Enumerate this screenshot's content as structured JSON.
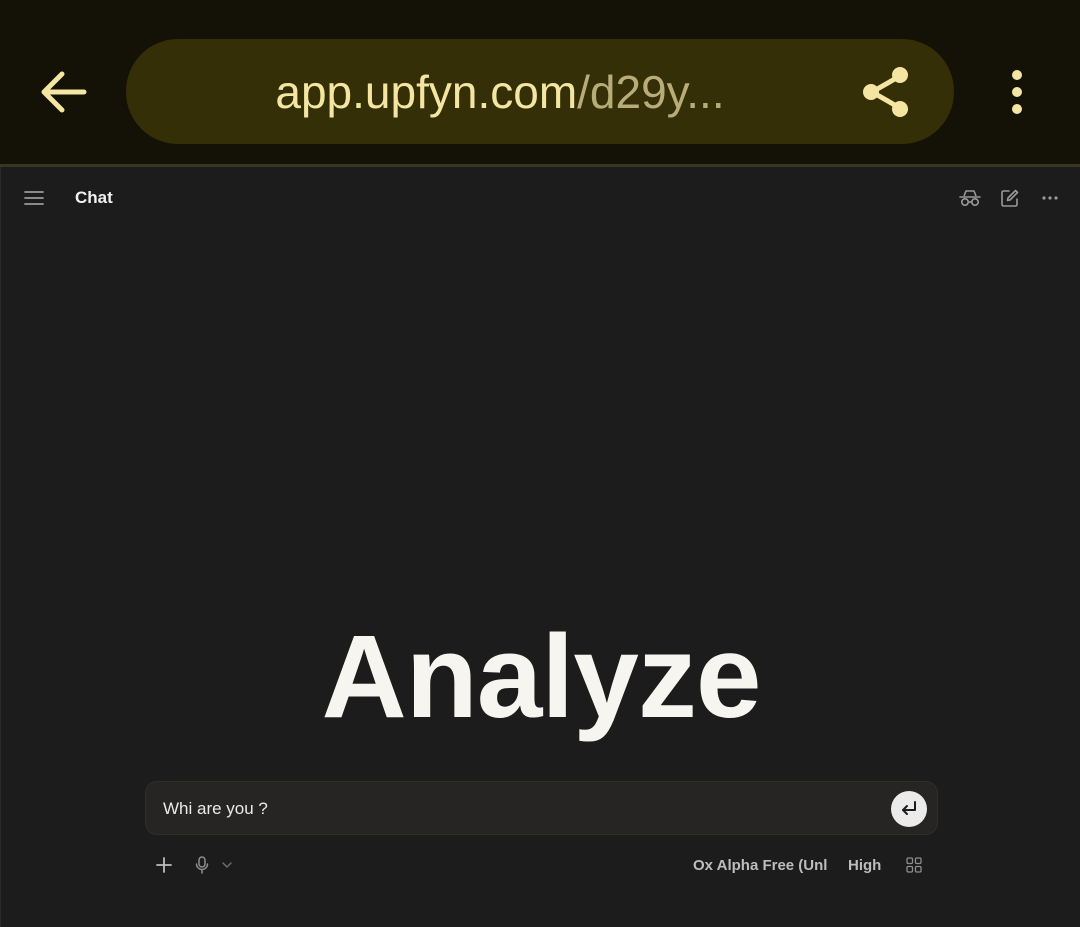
{
  "browser": {
    "url_host": "app.upfyn.com",
    "url_path": "/d29y...",
    "back_icon": "arrow-left-icon",
    "share_icon": "share-icon",
    "menu_icon": "more-vertical-icon",
    "colors": {
      "bar": "#141107",
      "pill": "#352f07",
      "accent": "#f4e6a2"
    }
  },
  "app": {
    "title": "Chat",
    "icons": [
      "menu-icon",
      "incognito-icon",
      "edit-icon",
      "more-horizontal-icon"
    ]
  },
  "hero": {
    "text": "Analyze"
  },
  "composer": {
    "value": "Whi are you ?",
    "send_icon": "enter-icon"
  },
  "toolbar": {
    "add_icon": "plus-icon",
    "mic_icon": "microphone-icon",
    "dropdown_icon": "chevron-down-icon",
    "model": "Ox Alpha Free (Unl",
    "effort": "High",
    "apps_icon": "grid-icon"
  }
}
